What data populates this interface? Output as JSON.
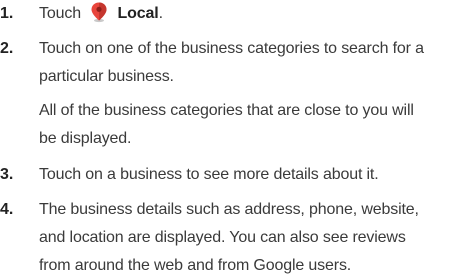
{
  "steps": [
    {
      "number": "1.",
      "prefix": "Touch",
      "icon": "map-pin-icon",
      "bold_label": "Local",
      "suffix": "."
    },
    {
      "number": "2.",
      "lines": [
        "Touch on one of the business categories to search for a",
        "particular business."
      ],
      "sub_lines": [
        "All of the business categories that are close to you will",
        "be displayed."
      ]
    },
    {
      "number": "3.",
      "lines": [
        "Touch on a business to see more details about it."
      ]
    },
    {
      "number": "4.",
      "lines": [
        "The business details such as address, phone, website,",
        "and location are displayed. You can also see reviews",
        "from around the web and from Google users."
      ]
    }
  ],
  "colors": {
    "pin_red": "#e8453c",
    "pin_dark": "#b3261e",
    "text": "#3a3a3a"
  }
}
